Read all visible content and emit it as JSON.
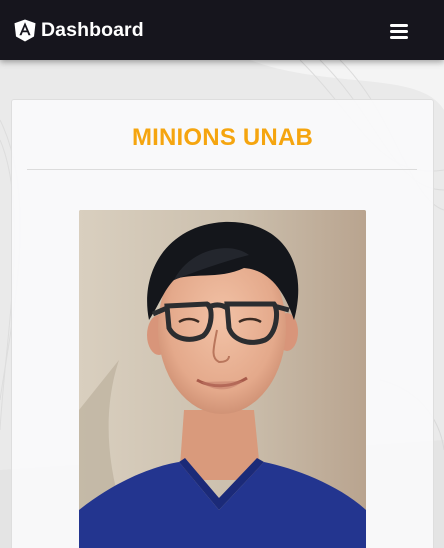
{
  "navbar": {
    "brand_label": "Dashboard",
    "brand_icon": "angular-shield-icon",
    "menu_icon": "hamburger-menu-icon",
    "background_color": "#16151d"
  },
  "card": {
    "title": "MINIONS UNAB",
    "title_color": "#f5a50f",
    "photo_icon": "person-photo"
  }
}
